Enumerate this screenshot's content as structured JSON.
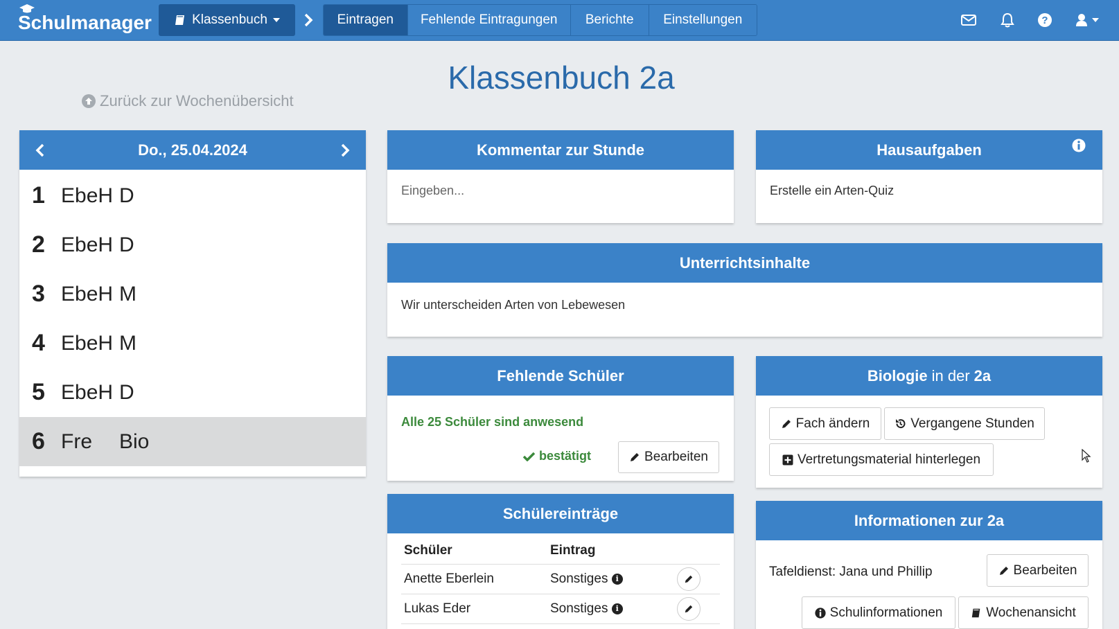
{
  "navbar": {
    "brand": "Schulmanager",
    "klassenbuch_label": "Klassenbuch",
    "tabs": [
      {
        "label": "Eintragen",
        "active": true
      },
      {
        "label": "Fehlende Eintragungen",
        "active": false
      },
      {
        "label": "Berichte",
        "active": false
      },
      {
        "label": "Einstellungen",
        "active": false
      }
    ],
    "icons": [
      "mail-icon",
      "bell-icon",
      "help-icon",
      "user-icon"
    ]
  },
  "page": {
    "title": "Klassenbuch 2a",
    "back_link": "Zurück zur Wochenübersicht"
  },
  "day": {
    "date": "Do., 25.04.2024",
    "lessons": [
      {
        "num": "1",
        "teacher": "EbeH",
        "subject": "D"
      },
      {
        "num": "2",
        "teacher": "EbeH",
        "subject": "D"
      },
      {
        "num": "3",
        "teacher": "EbeH",
        "subject": "M"
      },
      {
        "num": "4",
        "teacher": "EbeH",
        "subject": "M"
      },
      {
        "num": "5",
        "teacher": "EbeH",
        "subject": "D"
      },
      {
        "num": "6",
        "teacher": "Fre",
        "subject": "Bio",
        "selected": true
      }
    ]
  },
  "kommentar": {
    "title": "Kommentar zur Stunde",
    "placeholder": "Eingeben..."
  },
  "hausaufgaben": {
    "title": "Hausaufgaben",
    "text": "Erstelle ein Arten-Quiz"
  },
  "unterricht": {
    "title": "Unterrichtsinhalte",
    "text": "Wir unterscheiden Arten von Lebewesen"
  },
  "fehlende": {
    "title": "Fehlende Schüler",
    "status": "Alle 25 Schüler sind anwesend",
    "confirmed": "bestätigt",
    "edit": "Bearbeiten"
  },
  "fach": {
    "subject": "Biologie",
    "in_der": "in der",
    "class": "2a",
    "change": "Fach ändern",
    "past": "Vergangene Stunden",
    "material": "Vertretungsmaterial hinterlegen"
  },
  "schuelereintraege": {
    "title": "Schülereinträge",
    "col_student": "Schüler",
    "col_entry": "Eintrag",
    "rows": [
      {
        "student": "Anette Eberlein",
        "entry": "Sonstiges"
      },
      {
        "student": "Lukas Eder",
        "entry": "Sonstiges"
      }
    ]
  },
  "info": {
    "title": "Informationen zur 2a",
    "text": "Tafeldienst: Jana und Phillip",
    "edit": "Bearbeiten",
    "school_info": "Schulinformationen",
    "week_view": "Wochenansicht"
  }
}
